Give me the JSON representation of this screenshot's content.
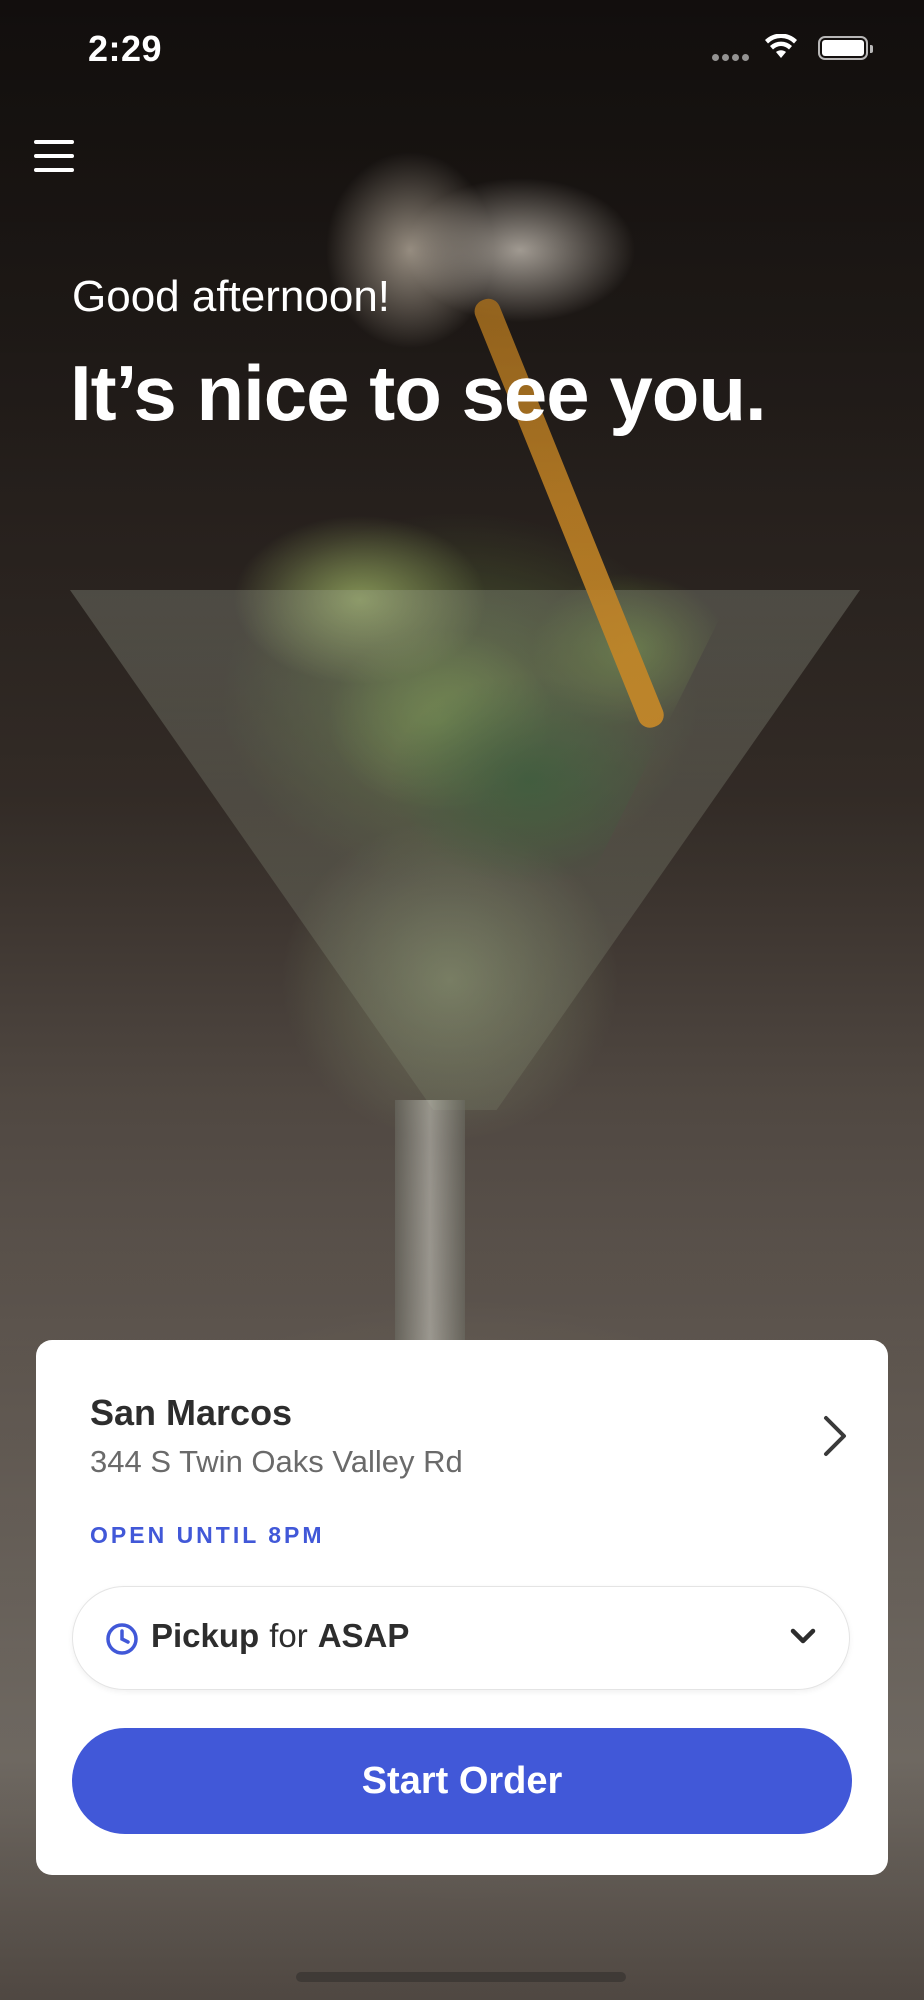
{
  "status_bar": {
    "time": "2:29"
  },
  "greeting": {
    "salutation": "Good afternoon!",
    "headline": "It’s nice to see you."
  },
  "location_card": {
    "name": "San Marcos",
    "address": "344 S Twin Oaks Valley Rd",
    "hours": "OPEN UNTIL 8PM",
    "order_mode": "Pickup",
    "connector": "for",
    "time": "ASAP",
    "start_button_label": "Start Order"
  },
  "icons": {
    "menu": "menu-icon",
    "location_arrow": "chevron-right-icon",
    "clock": "clock-icon",
    "dropdown": "chevron-down-icon"
  },
  "colors": {
    "accent": "#4158D8",
    "text_primary": "#2D2D2D",
    "text_secondary": "#6A6A6A"
  }
}
